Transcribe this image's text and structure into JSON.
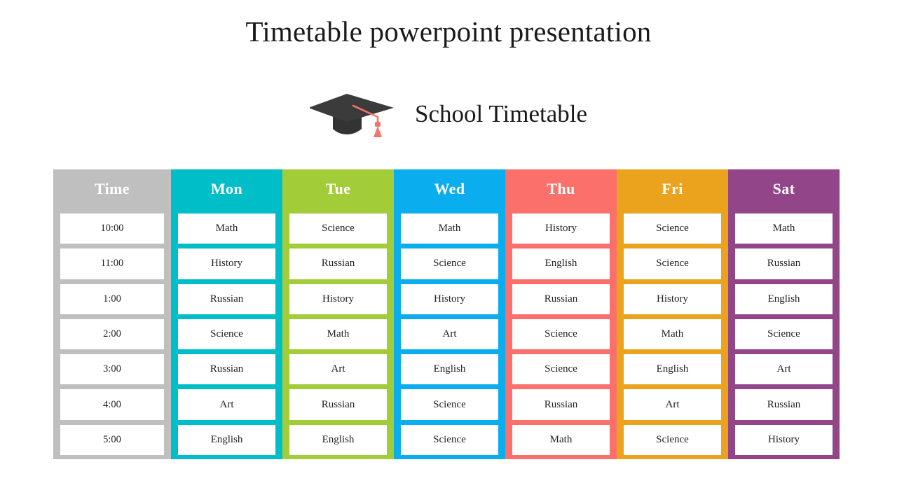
{
  "slide": {
    "title": "Timetable powerpoint presentation",
    "subtitle": "School Timetable",
    "background_color": "#ffffff",
    "icons": {
      "graduation_cap": "graduation-cap-icon",
      "cap_board_color": "#3b3b3b",
      "cap_base_color": "#333333",
      "tassel_color": "#f9726b"
    }
  },
  "timetable": {
    "columns": [
      {
        "key": "time",
        "header": "Time",
        "color": "#bfbfbf",
        "cells": [
          "10:00",
          "11:00",
          "1:00",
          "2:00",
          "3:00",
          "4:00",
          "5:00"
        ]
      },
      {
        "key": "mon",
        "header": "Mon",
        "color": "#00bec8",
        "cells": [
          "Math",
          "History",
          "Russian",
          "Science",
          "Russian",
          "Art",
          "English"
        ]
      },
      {
        "key": "tue",
        "header": "Tue",
        "color": "#a3cc39",
        "cells": [
          "Science",
          "Russian",
          "History",
          "Math",
          "Art",
          "Russian",
          "English"
        ]
      },
      {
        "key": "wed",
        "header": "Wed",
        "color": "#0aadee",
        "cells": [
          "Math",
          "Science",
          "History",
          "Art",
          "English",
          "Science",
          "Science"
        ]
      },
      {
        "key": "thu",
        "header": "Thu",
        "color": "#fb706b",
        "cells": [
          "History",
          "English",
          "Russian",
          "Science",
          "Science",
          "Russian",
          "Math"
        ]
      },
      {
        "key": "fri",
        "header": "Fri",
        "color": "#eba31e",
        "cells": [
          "Science",
          "Science",
          "History",
          "Math",
          "English",
          "Art",
          "Science"
        ]
      },
      {
        "key": "sat",
        "header": "Sat",
        "color": "#93458a",
        "cells": [
          "Math",
          "Russian",
          "English",
          "Science",
          "Art",
          "Russian",
          "History"
        ]
      }
    ]
  }
}
